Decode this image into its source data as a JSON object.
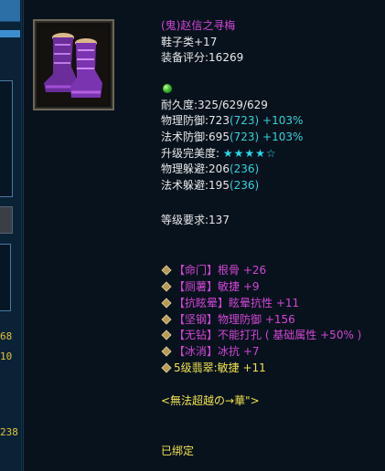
{
  "left_strip": {
    "numbers": [
      "68",
      "10",
      "238"
    ]
  },
  "item": {
    "name": "(鬼)赵信之寻梅",
    "type": "鞋子类+17",
    "score_label": "装备评分:",
    "score_value": "16269",
    "durability_label": "耐久度:",
    "durability_value": "325/629/629",
    "stats": [
      {
        "label": "物理防御:",
        "base": "723",
        "paren": "(723)",
        "bonus": " +103%"
      },
      {
        "label": "法术防御:",
        "base": "695",
        "paren": "(723)",
        "bonus": " +103%"
      }
    ],
    "upgrade_label": "升级完美度: ",
    "upgrade_stars": "★★★★☆",
    "dodges": [
      {
        "label": "物理躲避:",
        "base": "206",
        "paren": "(236)"
      },
      {
        "label": "法术躲避:",
        "base": "195",
        "paren": "(236)"
      }
    ],
    "level_req_label": "等级要求:",
    "level_req_value": "137",
    "gems": [
      {
        "text": "【命门】根骨 +26",
        "color": "#d246d6"
      },
      {
        "text": "【厕薯】敏捷 +9",
        "color": "#d246d6"
      },
      {
        "text": "【抗眩晕】眩晕抗性 +11",
        "color": "#d246d6"
      },
      {
        "text": "【坚钢】物理防御 +156",
        "color": "#d246d6"
      },
      {
        "text": "【无钻】不能打孔 ( 基础属性 +50% )",
        "color": "#d246d6"
      },
      {
        "text": "【冰消】冰抗 +7",
        "color": "#d246d6"
      },
      {
        "text": "5级翡翠:敏捷 +11",
        "color": "#f0e24e"
      }
    ],
    "set_name": "<無法超越の→華\">",
    "bound": "已绑定"
  },
  "colors": {
    "name": "#d246d6",
    "cyan": "#35d2d9",
    "gem_purple": "#d246d6",
    "gem_yellow": "#f0e24e"
  }
}
